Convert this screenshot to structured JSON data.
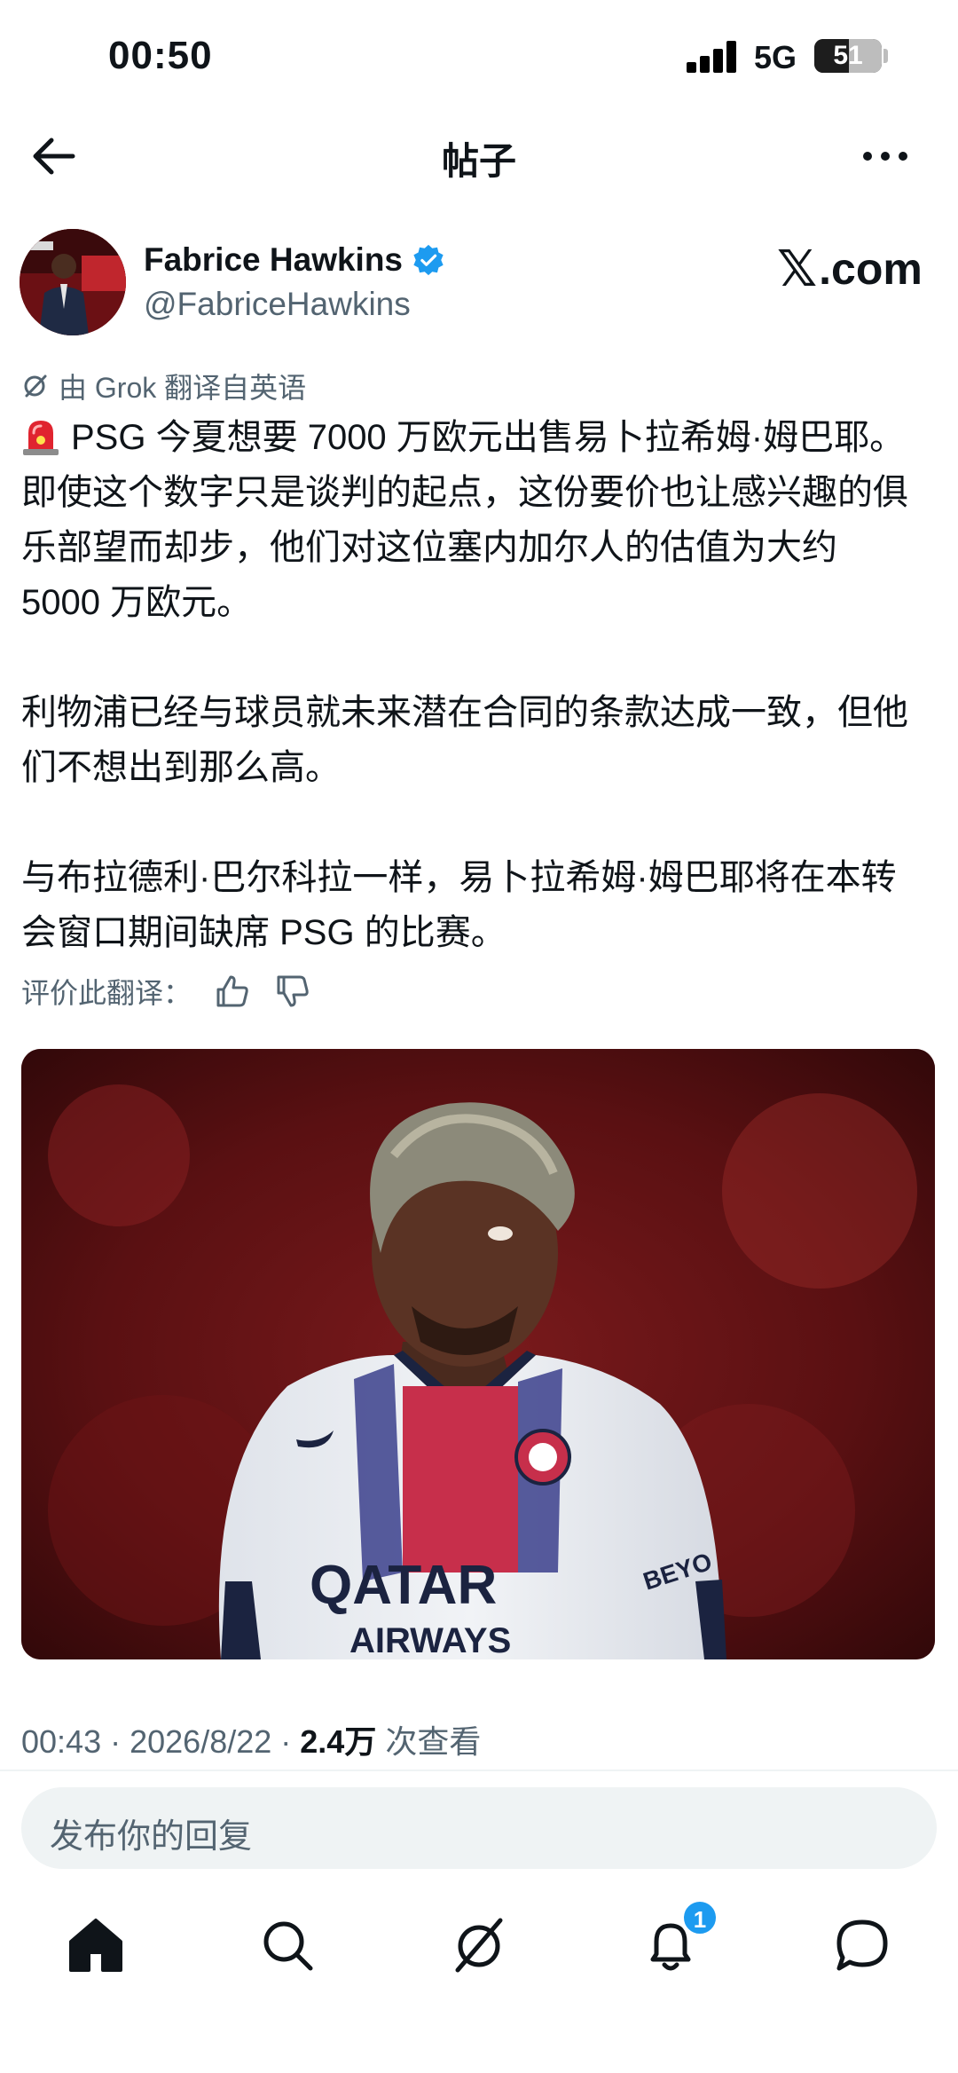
{
  "status_bar": {
    "time": "00:50",
    "network": "5G",
    "battery": "51",
    "battery_level": 0.51
  },
  "header": {
    "title": "帖子",
    "back_icon": "arrow-left-icon",
    "more_icon": "more-horizontal-icon"
  },
  "author": {
    "name": "Fabrice Hawkins",
    "handle": "@FabriceHawkins",
    "verified": true
  },
  "watermark": {
    "logo": "𝕏",
    "text": ".com"
  },
  "translation": {
    "note": "由 Grok 翻译自英语",
    "rate_label": "评价此翻译："
  },
  "post": {
    "paragraphs": [
      "PSG 今夏想要 7000 万欧元出售易卜拉希姆·姆巴耶。即使这个数字只是谈判的起点，这份要价也让感兴趣的俱乐部望而却步，他们对这位塞内加尔人的估值为大约 5000 万欧元。",
      "利物浦已经与球员就未来潜在合同的条款达成一致，但他们不想出到那么高。",
      "与布拉德利·巴尔科拉一样，易卜拉希姆·姆巴耶将在本转会窗口期间缺席 PSG 的比赛。"
    ],
    "lead_emoji": "siren-icon"
  },
  "meta": {
    "time": "00:43",
    "date": "2026/8/22",
    "views": "2.4万",
    "views_label": "次查看"
  },
  "reply": {
    "placeholder": "发布你的回复"
  },
  "tabbar": {
    "items": [
      "home-icon",
      "search-icon",
      "grok-icon",
      "notifications-icon",
      "messages-icon"
    ],
    "notification_badge": "1"
  },
  "colors": {
    "text": "#0f1419",
    "secondary": "#536471",
    "accent": "#1d9bf0",
    "divider": "#eff3f4"
  }
}
